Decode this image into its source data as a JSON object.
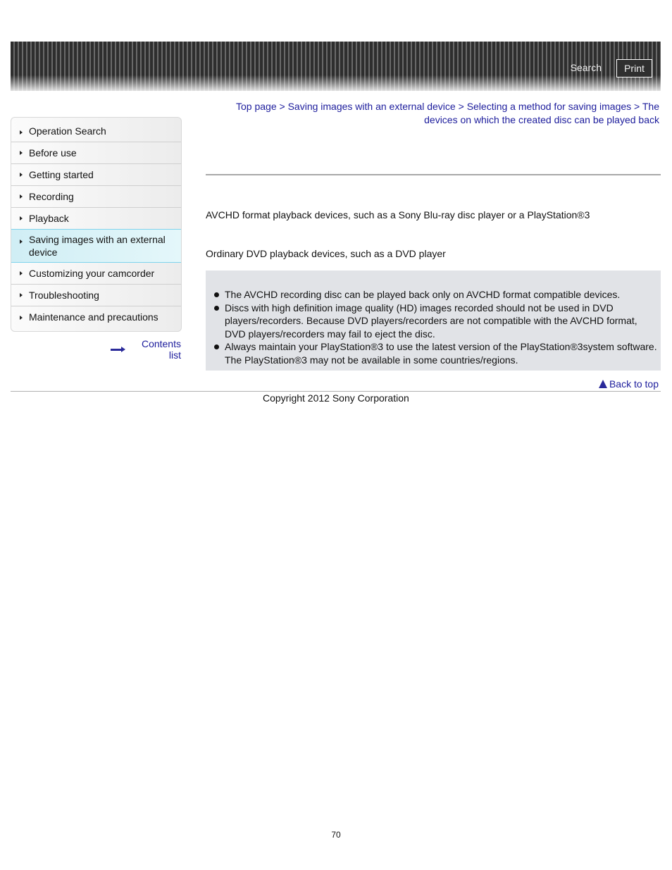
{
  "header": {
    "search_label": "Search",
    "print_label": "Print"
  },
  "sidebar": {
    "items": [
      {
        "label": "Operation Search"
      },
      {
        "label": "Before use"
      },
      {
        "label": "Getting started"
      },
      {
        "label": "Recording"
      },
      {
        "label": "Playback"
      },
      {
        "label": "Saving images with an external device",
        "active": true
      },
      {
        "label": "Customizing your camcorder"
      },
      {
        "label": "Troubleshooting"
      },
      {
        "label": "Maintenance and precautions"
      }
    ],
    "contents_list_label": "Contents list"
  },
  "breadcrumb": {
    "items": [
      {
        "label": "Top page"
      },
      {
        "label": "Saving images with an external device"
      },
      {
        "label": "Selecting a method for saving images"
      },
      {
        "label": "The devices on which the created disc can be played back"
      }
    ],
    "separator": ">"
  },
  "main": {
    "paragraphs": [
      "AVCHD format playback devices, such as a Sony Blu-ray disc player or a PlayStation®3",
      "Ordinary DVD playback devices, such as a DVD player"
    ],
    "notes": [
      "The AVCHD recording disc can be played back only on AVCHD format compatible devices.",
      "Discs with high definition image quality (HD) images recorded should not be used in DVD players/recorders. Because DVD players/recorders are not compatible with the AVCHD format, DVD players/recorders may fail to eject the disc.",
      "Always maintain your PlayStation®3 to use the latest version of the PlayStation®3system software. The PlayStation®3 may not be available in some countries/regions."
    ]
  },
  "footer": {
    "back_to_top_label": "Back to top",
    "copyright": "Copyright 2012 Sony Corporation",
    "page_number": "70"
  },
  "colors": {
    "link": "#1c1c9c",
    "active_nav_bg": "#d8f2f7",
    "active_nav_border": "#7fd3ec",
    "note_bg": "#e1e3e7"
  }
}
